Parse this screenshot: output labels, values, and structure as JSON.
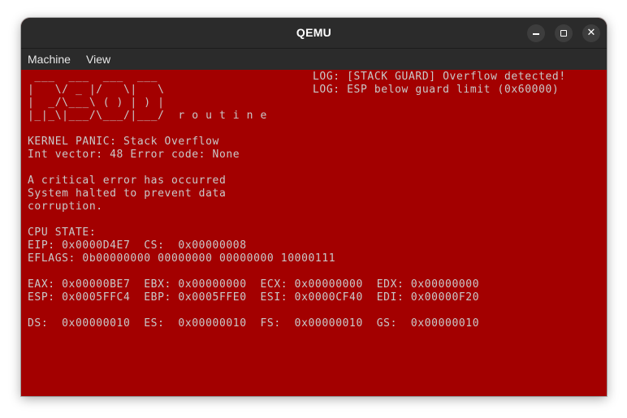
{
  "window": {
    "title": "QEMU",
    "controls": {
      "minimize_label": "",
      "maximize_label": "",
      "close_label": "✕"
    }
  },
  "menu": {
    "machine": "Machine",
    "view": "View"
  },
  "screen": {
    "background": "#a30000",
    "text_color": "#c9c9c9",
    "ascii_art": [
      " ___  ___  ___  ___",
      "|   \\/ _ |/   \\|   \\",
      "|  _/\\___\\ ( ) | ) |",
      "|_|_\\|___/\\___/|___/  r o u t i n e"
    ],
    "panic": {
      "title": "KERNEL PANIC: Stack Overflow",
      "vector": "Int vector: 48 Error code: None"
    },
    "message": [
      "A critical error has occurred",
      "System halted to prevent data",
      "corruption."
    ],
    "cpu": {
      "header": "CPU STATE:",
      "eip_cs": "EIP: 0x0000D4E7  CS:  0x00000008",
      "eflags": "EFLAGS: 0b00000000 00000000 00000000 10000111",
      "row1": "EAX: 0x00000BE7  EBX: 0x00000000  ECX: 0x00000000  EDX: 0x00000000",
      "row2": "ESP: 0x0005FFC4  EBP: 0x0005FFE0  ESI: 0x0000CF40  EDI: 0x00000F20",
      "row3": "DS:  0x00000010  ES:  0x00000010  FS:  0x00000010  GS:  0x00000010"
    },
    "log": [
      "LOG: [STACK GUARD] Overflow detected!",
      "LOG: ESP below guard limit (0x60000)"
    ]
  }
}
